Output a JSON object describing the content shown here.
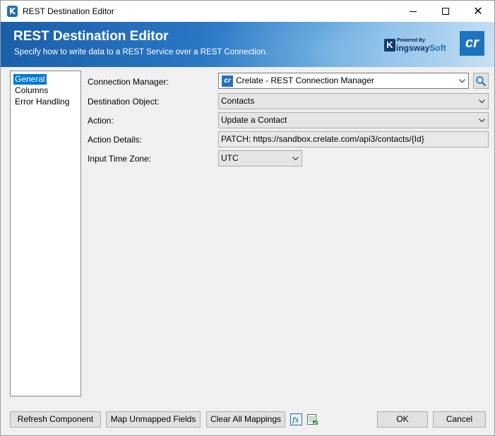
{
  "window": {
    "title": "REST Destination Editor"
  },
  "banner": {
    "title": "REST Destination Editor",
    "subtitle": "Specify how to write data to a REST Service over a REST Connection.",
    "powered_by": "Powered By",
    "brand_k": "K",
    "brand_ingsway": "ingsway",
    "brand_soft": "Soft",
    "cr_logo": "cr"
  },
  "nav": {
    "items": [
      {
        "label": "General",
        "selected": true
      },
      {
        "label": "Columns",
        "selected": false
      },
      {
        "label": "Error Handling",
        "selected": false
      }
    ]
  },
  "form": {
    "connection_manager": {
      "label": "Connection Manager:",
      "value": "Crelate - REST Connection Manager",
      "icon": "cr"
    },
    "destination_object": {
      "label": "Destination Object:",
      "value": "Contacts"
    },
    "action": {
      "label": "Action:",
      "value": "Update a Contact"
    },
    "action_details": {
      "label": "Action Details:",
      "value": "PATCH: https://sandbox.crelate.com/api3/contacts/{Id}"
    },
    "input_time_zone": {
      "label": "Input Time Zone:",
      "value": "UTC"
    }
  },
  "buttons": {
    "refresh": "Refresh Component",
    "map_unmapped": "Map Unmapped Fields",
    "clear_mappings": "Clear All Mappings",
    "fx_icon": "fx",
    "ok": "OK",
    "cancel": "Cancel"
  },
  "colors": {
    "accent": "#0078d7",
    "banner_start": "#1a5fa8",
    "brand_blue": "#1e73be"
  }
}
